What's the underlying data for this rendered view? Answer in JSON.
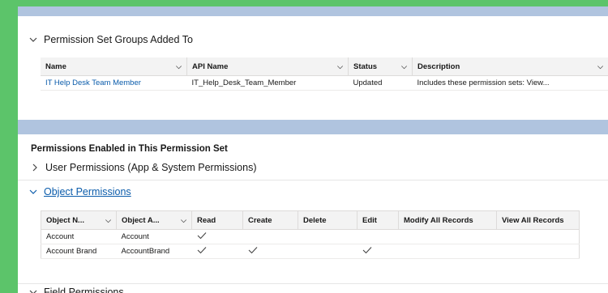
{
  "pset_groups": {
    "title": "Permission Set Groups Added To",
    "columns": [
      "Name",
      "API Name",
      "Status",
      "Description"
    ],
    "rows": [
      {
        "name": "IT Help Desk Team Member",
        "api_name": "IT_Help_Desk_Team_Member",
        "status": "Updated",
        "description": "Includes these permission sets: View..."
      }
    ]
  },
  "permissions": {
    "title": "Permissions Enabled in This Permission Set",
    "user_permissions": "User Permissions (App & System Permissions)",
    "object_permissions": "Object Permissions",
    "field_permissions": "Field Permissions",
    "columns": [
      "Object N...",
      "Object A...",
      "Read",
      "Create",
      "Delete",
      "Edit",
      "Modify All Records",
      "View All Records"
    ],
    "rows": [
      {
        "object_name": "Account",
        "object_api": "Account",
        "read": true,
        "create": false,
        "delete": false,
        "edit": false,
        "modify_all": false,
        "view_all": false
      },
      {
        "object_name": "Account Brand",
        "object_api": "AccountBrand",
        "read": true,
        "create": true,
        "delete": false,
        "edit": true,
        "modify_all": false,
        "view_all": false
      }
    ]
  },
  "colors": {
    "link": "#0b5cab",
    "background": "#5cc46a",
    "band": "#b0c4df"
  }
}
